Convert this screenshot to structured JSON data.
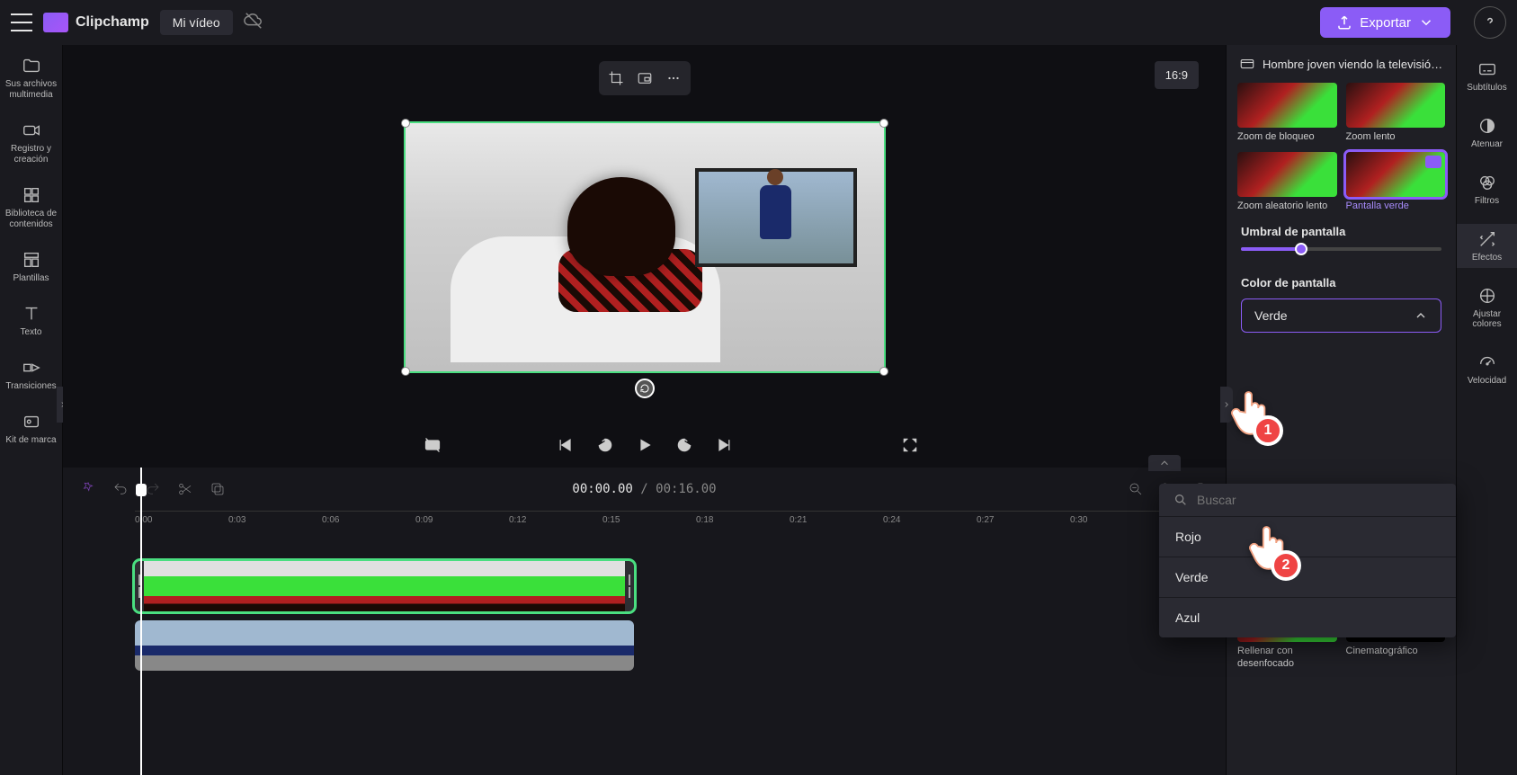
{
  "topbar": {
    "brand": "Clipchamp",
    "project_name": "Mi vídeo",
    "export_label": "Exportar"
  },
  "left_sidebar": {
    "items": [
      {
        "label": "Sus archivos multimedia"
      },
      {
        "label": "Registro y creación"
      },
      {
        "label": "Biblioteca de contenidos"
      },
      {
        "label": "Plantillas"
      },
      {
        "label": "Texto"
      },
      {
        "label": "Transiciones"
      },
      {
        "label": "Kit de marca"
      }
    ]
  },
  "preview": {
    "aspect": "16:9"
  },
  "timeline": {
    "current": "00:00.00",
    "total": "00:16.00",
    "ticks": [
      "0:00",
      "0:03",
      "0:06",
      "0:09",
      "0:12",
      "0:15",
      "0:18",
      "0:21",
      "0:24",
      "0:27",
      "0:30"
    ]
  },
  "right_panel": {
    "clip_title": "Hombre joven viendo la televisión...",
    "fx": [
      {
        "label": "Zoom de bloqueo"
      },
      {
        "label": "Zoom lento"
      },
      {
        "label": "Zoom aleatorio lento"
      },
      {
        "label": "Pantalla verde",
        "selected": true
      }
    ],
    "threshold_label": "Umbral de pantalla",
    "color_label": "Color de pantalla",
    "color_value": "Verde",
    "more_fx": [
      {
        "label": "Rellenar con desenfocado"
      },
      {
        "label": "Cinematográfico"
      }
    ]
  },
  "right_rail": {
    "items": [
      {
        "label": "Subtítulos"
      },
      {
        "label": "Atenuar"
      },
      {
        "label": "Filtros"
      },
      {
        "label": "Efectos",
        "active": true
      },
      {
        "label": "Ajustar colores"
      },
      {
        "label": "Velocidad"
      }
    ]
  },
  "color_dropdown": {
    "search_placeholder": "Buscar",
    "options": [
      "Rojo",
      "Verde",
      "Azul"
    ]
  },
  "cursors": {
    "c1": "1",
    "c2": "2"
  }
}
